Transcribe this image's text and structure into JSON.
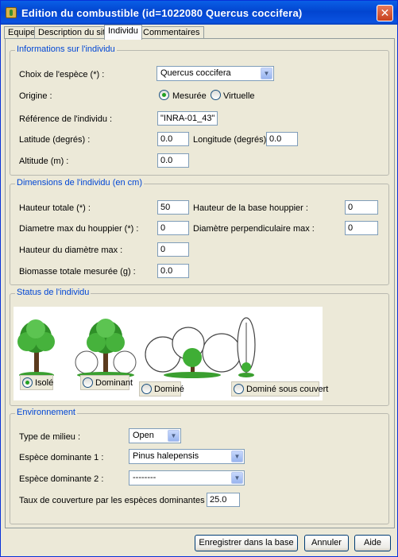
{
  "window": {
    "title": "Edition du combustible  (id=1022080 Quercus coccifera)",
    "close": "✕"
  },
  "tabs": [
    "Equipe",
    "Description du site",
    "Individu",
    "Commentaires"
  ],
  "individual_info": {
    "title": "Informations sur l'individu",
    "species_label": "Choix de l'espèce  (*) :",
    "species_value": "Quercus coccifera",
    "origin_label": "Origine :",
    "origin_measured": "Mesurée",
    "origin_virtual": "Virtuelle",
    "reference_label": "Référence de l'individu :",
    "reference_value": "\"INRA-01_43\"",
    "latitude_label": "Latitude (degrés) :",
    "latitude_value": "0.0",
    "longitude_label": "Longitude (degrés) :",
    "longitude_value": "0.0",
    "altitude_label": "Altitude (m) :",
    "altitude_value": "0.0"
  },
  "dimensions": {
    "title": "Dimensions de l'individu (en cm)",
    "height_total_label": "Hauteur totale  (*)  :",
    "height_total_value": "50",
    "crown_base_label": "Hauteur de la base houppier :",
    "crown_base_value": "0",
    "crown_diam_label": "Diametre max du houppier (*)  :",
    "crown_diam_value": "0",
    "perp_diam_label": "Diamètre perpendiculaire max :",
    "perp_diam_value": "0",
    "max_diam_height_label": "Hauteur du diamètre max :",
    "max_diam_height_value": "0",
    "biomass_label": "Biomasse totale mesurée (g) :",
    "biomass_value": "0.0"
  },
  "status": {
    "title": "Status de l'individu",
    "options": [
      "Isolé",
      "Dominant",
      "Dominé",
      "Dominé sous couvert"
    ],
    "selected": "Isolé"
  },
  "environment": {
    "title": "Environnement",
    "milieu_label": "Type de milieu :",
    "milieu_value": "Open",
    "dominant1_label": "Espèce dominante 1 :",
    "dominant1_value": "Pinus halepensis",
    "dominant2_label": "Espèce dominante 2 :",
    "dominant2_value": "--------",
    "cover_label": "Taux de couverture par les espèces dominantes (%)  :",
    "cover_value": "25.0"
  },
  "footer": {
    "save": "Enregistrer dans la base",
    "cancel": "Annuler",
    "help": "Aide"
  },
  "colors": {
    "title_bar": "#0245d0",
    "group_title": "#0046d5",
    "selected_radio": "#21a121"
  }
}
